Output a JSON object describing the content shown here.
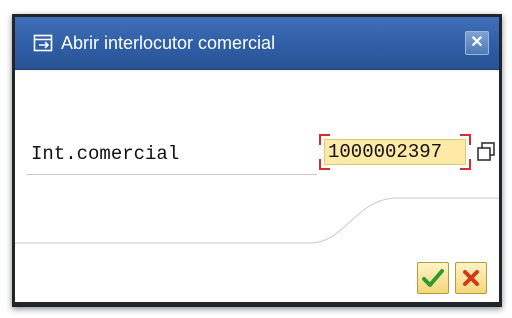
{
  "dialog": {
    "title": "Abrir interlocutor comercial",
    "title_icon": "open-document-icon",
    "close_icon": "close-icon",
    "close_symbol": "✕"
  },
  "form": {
    "field_label": "Int.comercial",
    "field_value": "1000002397",
    "help_icon": "copy-icon"
  },
  "actions": {
    "confirm_icon": "checkmark-icon",
    "cancel_icon": "cancel-icon"
  },
  "colors": {
    "titlebar": "#2f5ea6",
    "input_background": "#ffe9a6",
    "required_marker": "#d32f2f",
    "confirm_green": "#2e9a2e",
    "cancel_red": "#d03a1a"
  }
}
